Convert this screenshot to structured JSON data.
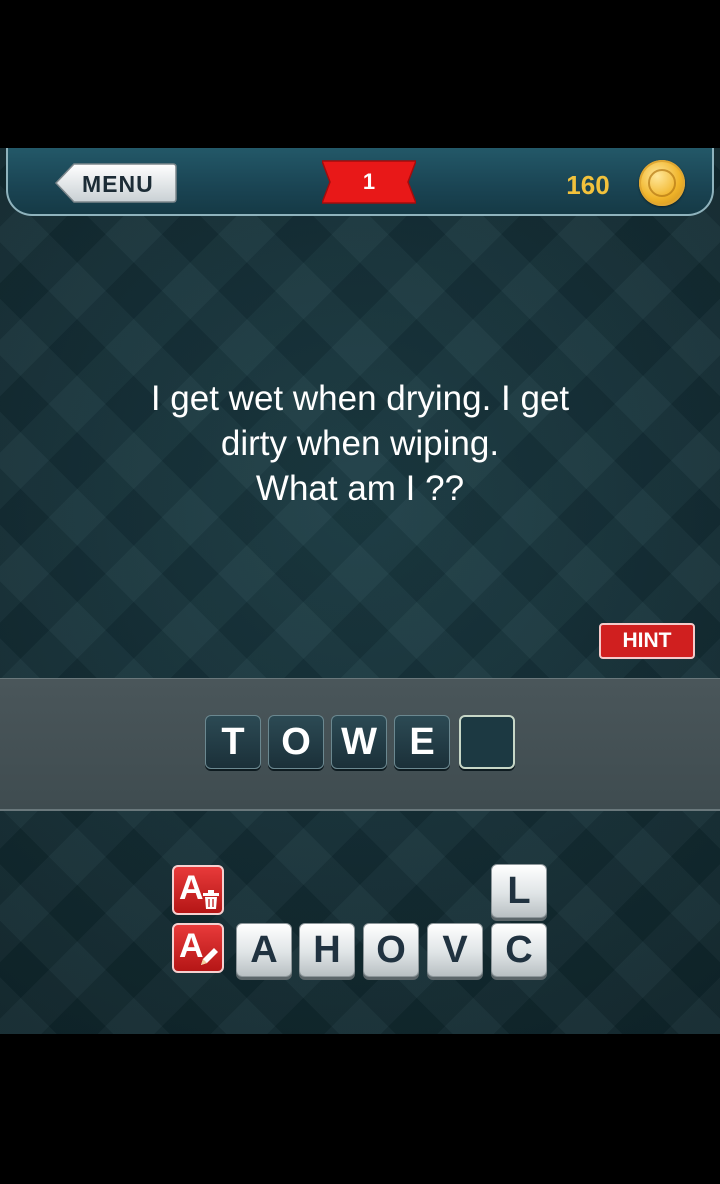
{
  "header": {
    "menu_label": "MENU",
    "level": "1",
    "coins": "160",
    "icons": [
      "menu-arrow-icon",
      "coin-icon"
    ]
  },
  "riddle": {
    "line1": "I get wet when drying. I get",
    "line2": "dirty when wiping.",
    "line3": "What am I ??"
  },
  "hint_label": "HINT",
  "answer_slots": [
    "T",
    "O",
    "W",
    "E",
    ""
  ],
  "letter_tiles": {
    "top_row": [
      "L"
    ],
    "bottom_row": [
      "A",
      "H",
      "O",
      "V",
      "C"
    ]
  },
  "tools": {
    "remove_letters": {
      "letter": "A",
      "icon": "trash-icon"
    },
    "reveal_letter": {
      "letter": "A",
      "icon": "pencil-icon"
    }
  },
  "colors": {
    "accent_red": "#d01f1f",
    "coin_gold": "#f2c23c",
    "background": "#15323a"
  }
}
